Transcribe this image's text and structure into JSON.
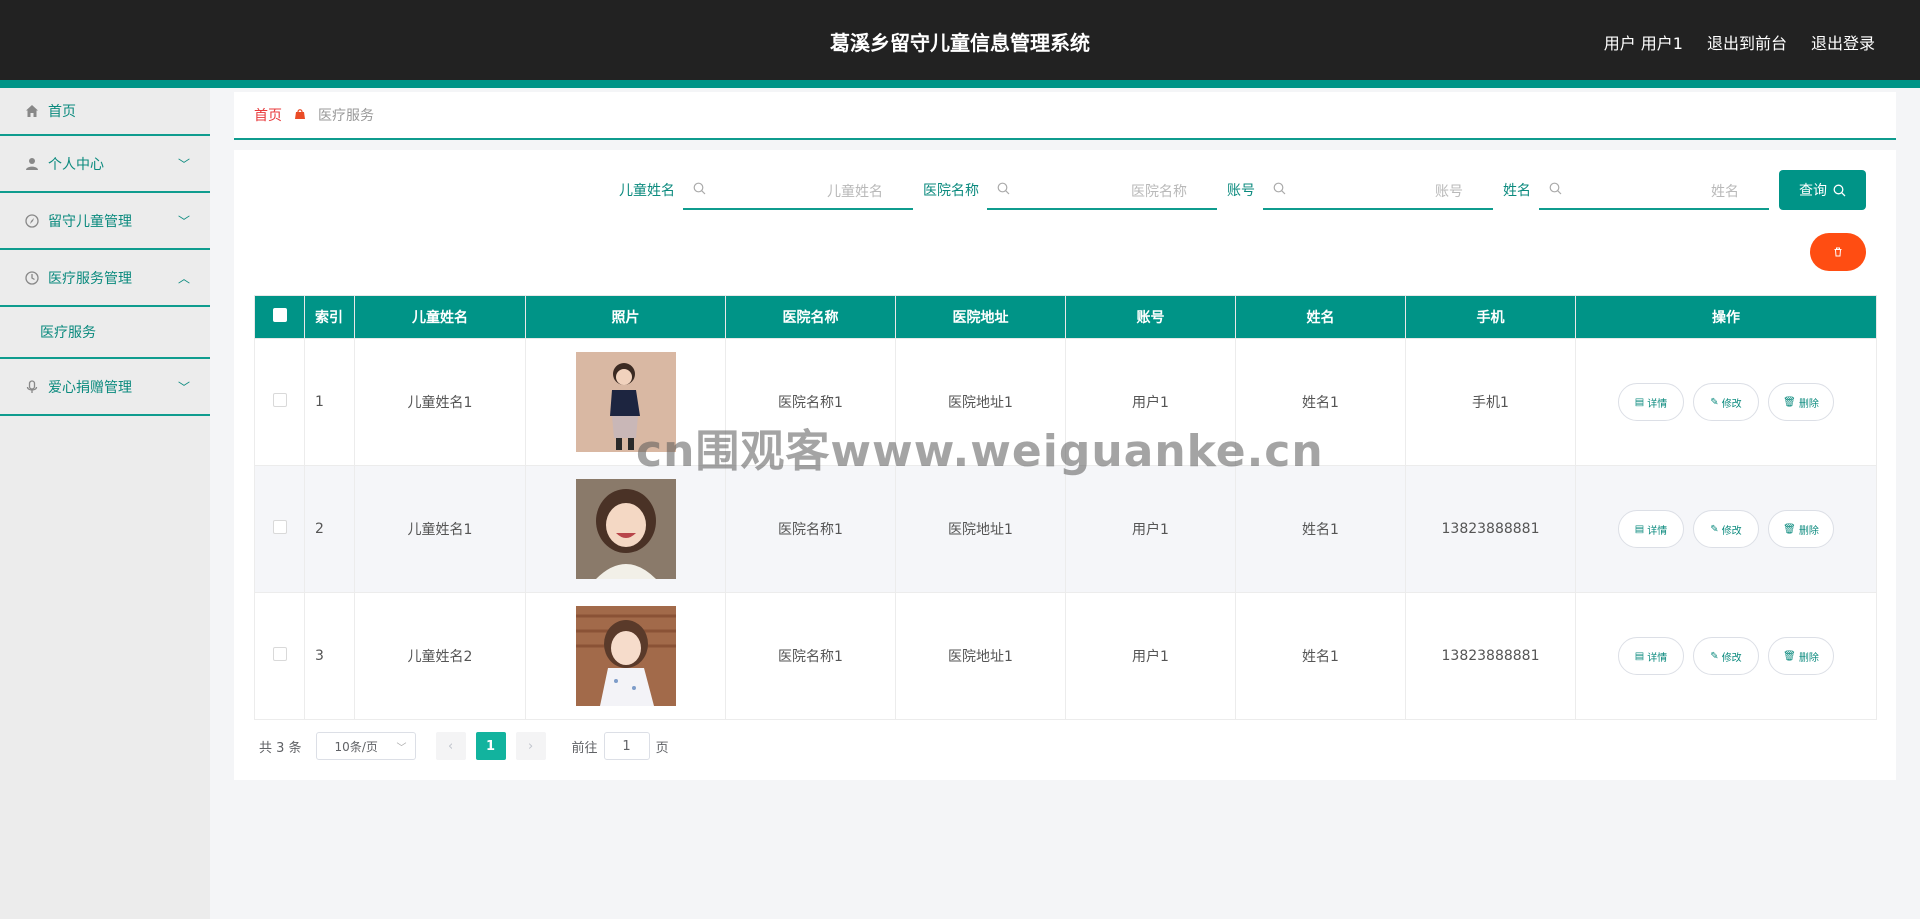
{
  "header": {
    "title": "葛溪乡留守儿童信息管理系统",
    "user_label": "用户 用户1",
    "front_label": "退出到前台",
    "logout_label": "退出登录"
  },
  "sidebar": {
    "items": [
      {
        "label": "首页",
        "icon": "home-icon"
      },
      {
        "label": "个人中心",
        "icon": "user-icon"
      },
      {
        "label": "留守儿童管理",
        "icon": "compass-icon"
      },
      {
        "label": "医疗服务管理",
        "icon": "clock-icon",
        "sub": "医疗服务"
      },
      {
        "label": "爱心捐赠管理",
        "icon": "mic-icon"
      }
    ]
  },
  "breadcrumb": {
    "home": "首页",
    "current": "医疗服务"
  },
  "search": {
    "fields": [
      {
        "label": "儿童姓名",
        "placeholder": "儿童姓名"
      },
      {
        "label": "医院名称",
        "placeholder": "医院名称"
      },
      {
        "label": "账号",
        "placeholder": "账号"
      },
      {
        "label": "姓名",
        "placeholder": "姓名"
      }
    ],
    "button_label": "查询"
  },
  "table": {
    "headers": [
      "索引",
      "儿童姓名",
      "照片",
      "医院名称",
      "医院地址",
      "账号",
      "姓名",
      "手机",
      "操作"
    ],
    "rows": [
      {
        "index": "1",
        "child": "儿童姓名1",
        "hospital": "医院名称1",
        "address": "医院地址1",
        "account": "用户1",
        "name": "姓名1",
        "phone": "手机1"
      },
      {
        "index": "2",
        "child": "儿童姓名1",
        "hospital": "医院名称1",
        "address": "医院地址1",
        "account": "用户1",
        "name": "姓名1",
        "phone": "13823888881"
      },
      {
        "index": "3",
        "child": "儿童姓名2",
        "hospital": "医院名称1",
        "address": "医院地址1",
        "account": "用户1",
        "name": "姓名1",
        "phone": "13823888881"
      }
    ],
    "ops": {
      "detail": "详情",
      "edit": "修改",
      "delete": "删除"
    }
  },
  "pagination": {
    "total": "共 3 条",
    "page_size": "10条/页",
    "current": "1",
    "goto_prefix": "前往",
    "goto_value": "1",
    "goto_suffix": "页"
  },
  "watermark": "cn围观客www.weiguanke.cn",
  "colors": {
    "accent": "#009487",
    "danger": "#ff4d12",
    "header_bg": "#222222"
  }
}
